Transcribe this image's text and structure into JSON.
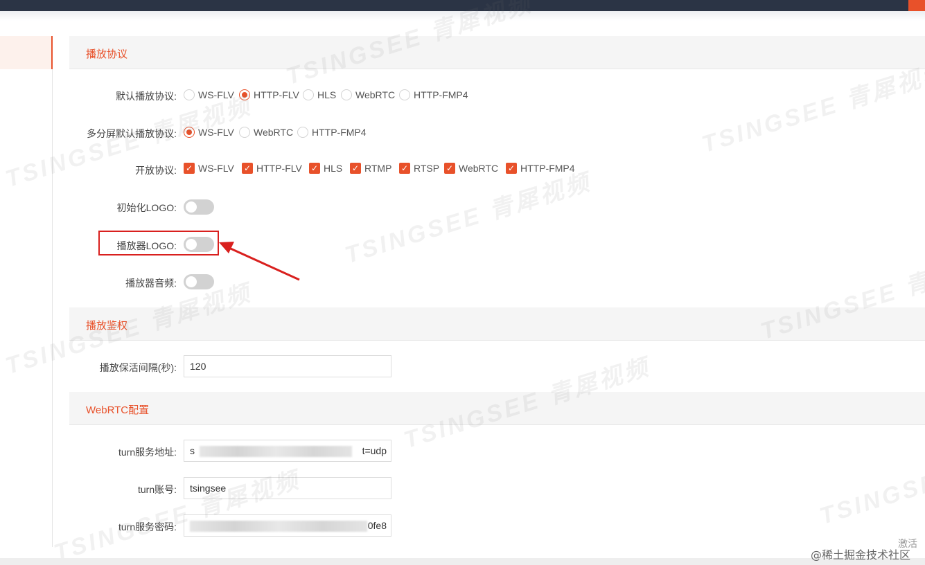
{
  "colors": {
    "accent": "#e8512a",
    "topbar": "#2b3445",
    "highlight": "#d9201e"
  },
  "sections": {
    "playback_protocol": "播放协议",
    "playback_auth": "播放鉴权",
    "webrtc_config": "WebRTC配置"
  },
  "default_protocol": {
    "label": "默认播放协议:",
    "options": [
      "WS-FLV",
      "HTTP-FLV",
      "HLS",
      "WebRTC",
      "HTTP-FMP4"
    ],
    "selected": "HTTP-FLV"
  },
  "multi_screen_protocol": {
    "label": "多分屏默认播放协议:",
    "options": [
      "WS-FLV",
      "WebRTC",
      "HTTP-FMP4"
    ],
    "selected": "WS-FLV"
  },
  "open_protocols": {
    "label": "开放协议:",
    "options": [
      "WS-FLV",
      "HTTP-FLV",
      "HLS",
      "RTMP",
      "RTSP",
      "WebRTC",
      "HTTP-FMP4"
    ],
    "checked": [
      "WS-FLV",
      "HTTP-FLV",
      "HLS",
      "RTMP",
      "RTSP",
      "WebRTC",
      "HTTP-FMP4"
    ]
  },
  "init_logo": {
    "label": "初始化LOGO:",
    "enabled": false
  },
  "player_logo": {
    "label": "播放器LOGO:",
    "enabled": false
  },
  "player_audio": {
    "label": "播放器音频:",
    "enabled": false
  },
  "keepalive": {
    "label": "播放保活间隔(秒):",
    "value": "120"
  },
  "turn_server": {
    "label": "turn服务地址:",
    "prefix": "s",
    "suffix": "t=udp"
  },
  "turn_account": {
    "label": "turn账号:",
    "value": "tsingsee"
  },
  "turn_password": {
    "label": "turn服务密码:",
    "suffix": "0fe8"
  },
  "watermark": {
    "text": "TSINGSEE",
    "cn": "青犀视频"
  },
  "corner": {
    "text": "@稀土掘金技术社区",
    "text2": "激活"
  }
}
